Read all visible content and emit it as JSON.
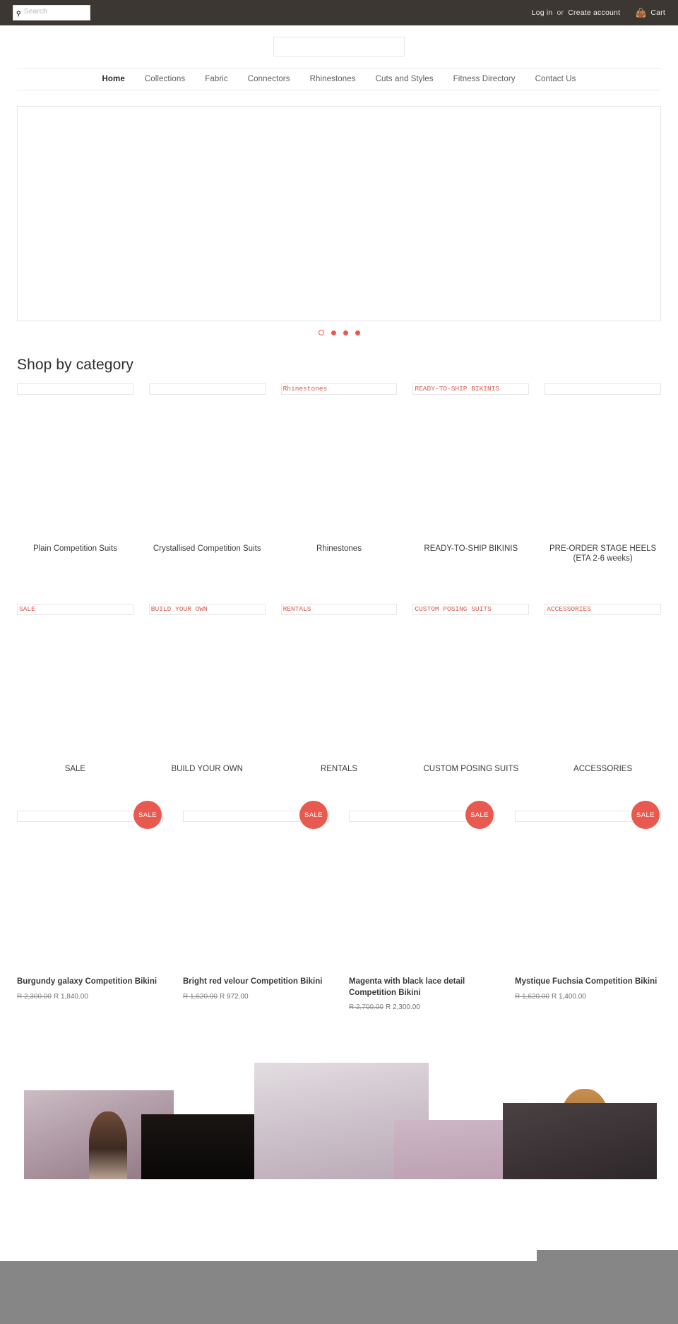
{
  "topbar": {
    "search": {
      "placeholder": "Search",
      "icon": "search-icon",
      "value": ""
    },
    "login_label": "Log in",
    "or_label": "or",
    "create_account_label": "Create account",
    "cart_label": "Cart",
    "cart_icon": "shopping-cart-icon",
    "background_color": "#3d3733"
  },
  "header": {
    "logo_alt": ""
  },
  "nav": {
    "items": [
      {
        "label": "Home",
        "active": true
      },
      {
        "label": "Collections",
        "active": false
      },
      {
        "label": "Fabric",
        "active": false
      },
      {
        "label": "Connectors",
        "active": false
      },
      {
        "label": "Rhinestones",
        "active": false
      },
      {
        "label": "Cuts and Styles",
        "active": false
      },
      {
        "label": "Fitness Directory",
        "active": false
      },
      {
        "label": "Contact Us",
        "active": false
      }
    ]
  },
  "hero": {
    "slides_total": 4,
    "active_slide": 1,
    "dot_color": "#e8594f"
  },
  "shop_by_category": {
    "title": "Shop by category",
    "row1": [
      {
        "label": "Plain Competition Suits",
        "alt_text": ""
      },
      {
        "label": "Crystallised Competition Suits",
        "alt_text": ""
      },
      {
        "label": "Rhinestones",
        "alt_text": "Rhinestones"
      },
      {
        "label": "READY-TO-SHIP BIKINIS",
        "alt_text": "READY-TO-SHIP BIKINIS"
      },
      {
        "label": "PRE-ORDER STAGE HEELS (ETA 2-6 weeks)",
        "alt_text": ""
      }
    ],
    "row2": [
      {
        "label": "SALE",
        "alt_text": "SALE"
      },
      {
        "label": "BUILD YOUR OWN",
        "alt_text": "BUILD YOUR OWN"
      },
      {
        "label": "RENTALS",
        "alt_text": "RENTALS"
      },
      {
        "label": "CUSTOM POSING SUITS",
        "alt_text": "CUSTOM POSING SUITS"
      },
      {
        "label": "ACCESSORIES",
        "alt_text": "ACCESSORIES"
      }
    ]
  },
  "products": {
    "badge_label": "SALE",
    "badge_color": "#e8594f",
    "items": [
      {
        "title": "Burgundy galaxy Competition Bikini",
        "price_old": "R 2,300.00",
        "price_new": "R 1,840.00",
        "on_sale": true
      },
      {
        "title": "Bright red velour Competition Bikini",
        "price_old": "R 1,620.00",
        "price_new": "R 972.00",
        "on_sale": true
      },
      {
        "title": "Magenta with black lace detail Competition Bikini",
        "price_old": "R 2,700.00",
        "price_new": "R 2,300.00",
        "on_sale": true
      },
      {
        "title": "Mystique Fuchsia Competition Bikini",
        "price_old": "R 1,620.00",
        "price_new": "R 1,400.00",
        "on_sale": true
      }
    ]
  },
  "gallery": {
    "photo_count": 5,
    "overlay_color": "#868686"
  }
}
